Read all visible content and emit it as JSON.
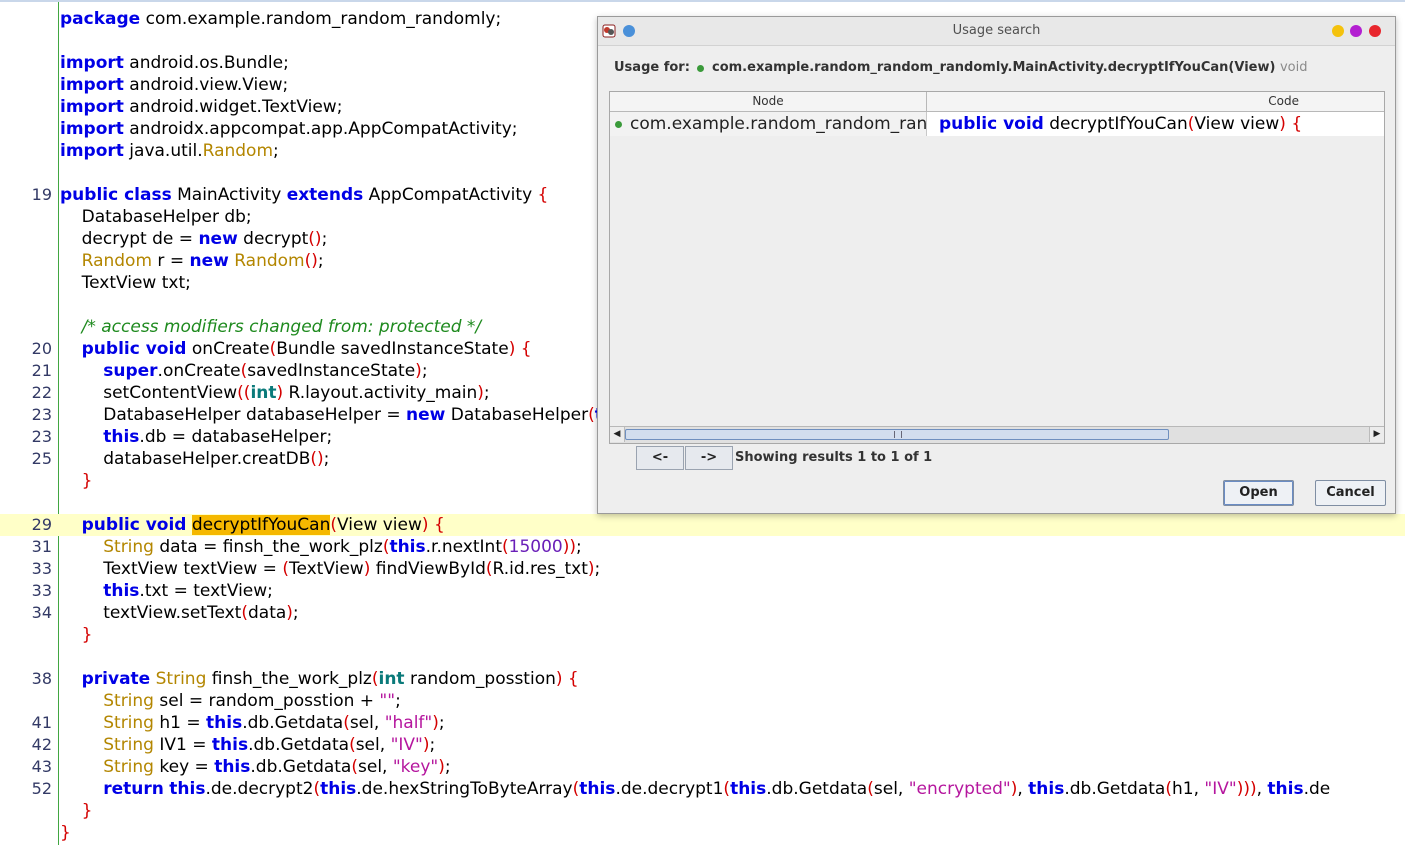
{
  "editor": {
    "lines": [
      {
        "num": "",
        "tokens": [
          {
            "t": "package",
            "c": "kw"
          },
          {
            "t": " com.example.random_random_randomly;",
            "c": ""
          }
        ]
      },
      {
        "num": "",
        "tokens": []
      },
      {
        "num": "",
        "tokens": [
          {
            "t": "import",
            "c": "kw"
          },
          {
            "t": " android.os.Bundle;",
            "c": ""
          }
        ]
      },
      {
        "num": "",
        "tokens": [
          {
            "t": "import",
            "c": "kw"
          },
          {
            "t": " android.view.View;",
            "c": ""
          }
        ]
      },
      {
        "num": "",
        "tokens": [
          {
            "t": "import",
            "c": "kw"
          },
          {
            "t": " android.widget.TextView;",
            "c": ""
          }
        ]
      },
      {
        "num": "",
        "tokens": [
          {
            "t": "import",
            "c": "kw"
          },
          {
            "t": " androidx.appcompat.app.AppCompatActivity;",
            "c": ""
          }
        ]
      },
      {
        "num": "",
        "tokens": [
          {
            "t": "import",
            "c": "kw"
          },
          {
            "t": " java.util.",
            "c": ""
          },
          {
            "t": "Random",
            "c": "ty"
          },
          {
            "t": ";",
            "c": ""
          }
        ]
      },
      {
        "num": "",
        "tokens": []
      },
      {
        "num": "19",
        "tokens": [
          {
            "t": "public class",
            "c": "kw"
          },
          {
            "t": " MainActivity ",
            "c": ""
          },
          {
            "t": "extends",
            "c": "kw"
          },
          {
            "t": " AppCompatActivity ",
            "c": ""
          },
          {
            "t": "{",
            "c": "br"
          }
        ]
      },
      {
        "num": "",
        "tokens": [
          {
            "t": "    DatabaseHelper db;",
            "c": ""
          }
        ]
      },
      {
        "num": "",
        "tokens": [
          {
            "t": "    decrypt de = ",
            "c": ""
          },
          {
            "t": "new",
            "c": "kw"
          },
          {
            "t": " decrypt",
            "c": ""
          },
          {
            "t": "()",
            "c": "br"
          },
          {
            "t": ";",
            "c": ""
          }
        ]
      },
      {
        "num": "",
        "tokens": [
          {
            "t": "    ",
            "c": ""
          },
          {
            "t": "Random",
            "c": "ty"
          },
          {
            "t": " r = ",
            "c": ""
          },
          {
            "t": "new",
            "c": "kw"
          },
          {
            "t": " ",
            "c": ""
          },
          {
            "t": "Random",
            "c": "ty"
          },
          {
            "t": "()",
            "c": "br"
          },
          {
            "t": ";",
            "c": ""
          }
        ]
      },
      {
        "num": "",
        "tokens": [
          {
            "t": "    TextView txt;",
            "c": ""
          }
        ]
      },
      {
        "num": "",
        "tokens": []
      },
      {
        "num": "",
        "tokens": [
          {
            "t": "    /* access modifiers changed from: protected */",
            "c": "cm"
          }
        ]
      },
      {
        "num": "20",
        "tokens": [
          {
            "t": "    ",
            "c": ""
          },
          {
            "t": "public void",
            "c": "kw"
          },
          {
            "t": " onCreate",
            "c": ""
          },
          {
            "t": "(",
            "c": "br"
          },
          {
            "t": "Bundle savedInstanceState",
            "c": ""
          },
          {
            "t": ")",
            "c": "br"
          },
          {
            "t": " ",
            "c": ""
          },
          {
            "t": "{",
            "c": "br"
          }
        ]
      },
      {
        "num": "21",
        "tokens": [
          {
            "t": "        ",
            "c": ""
          },
          {
            "t": "super",
            "c": "kw"
          },
          {
            "t": ".onCreate",
            "c": ""
          },
          {
            "t": "(",
            "c": "br"
          },
          {
            "t": "savedInstanceState",
            "c": ""
          },
          {
            "t": ")",
            "c": "br"
          },
          {
            "t": ";",
            "c": ""
          }
        ]
      },
      {
        "num": "22",
        "tokens": [
          {
            "t": "        setContentView",
            "c": ""
          },
          {
            "t": "((",
            "c": "br"
          },
          {
            "t": "int",
            "c": "kt"
          },
          {
            "t": ")",
            "c": "br"
          },
          {
            "t": " R.layout.activity_main",
            "c": ""
          },
          {
            "t": ")",
            "c": "br"
          },
          {
            "t": ";",
            "c": ""
          }
        ]
      },
      {
        "num": "23",
        "tokens": [
          {
            "t": "        DatabaseHelper databaseHelper = ",
            "c": ""
          },
          {
            "t": "new",
            "c": "kw"
          },
          {
            "t": " DatabaseHelper",
            "c": ""
          },
          {
            "t": "(",
            "c": "br"
          },
          {
            "t": "this",
            "c": "kw"
          },
          {
            "t": ")",
            "c": "br"
          },
          {
            "t": ";",
            "c": ""
          }
        ]
      },
      {
        "num": "23",
        "tokens": [
          {
            "t": "        ",
            "c": ""
          },
          {
            "t": "this",
            "c": "kw"
          },
          {
            "t": ".db = databaseHelper;",
            "c": ""
          }
        ]
      },
      {
        "num": "25",
        "tokens": [
          {
            "t": "        databaseHelper.creatDB",
            "c": ""
          },
          {
            "t": "()",
            "c": "br"
          },
          {
            "t": ";",
            "c": ""
          }
        ]
      },
      {
        "num": "",
        "tokens": [
          {
            "t": "    ",
            "c": ""
          },
          {
            "t": "}",
            "c": "br"
          }
        ]
      },
      {
        "num": "",
        "tokens": []
      },
      {
        "num": "29",
        "hl": true,
        "tokens": [
          {
            "t": "    ",
            "c": ""
          },
          {
            "t": "public void",
            "c": "kw"
          },
          {
            "t": " ",
            "c": ""
          },
          {
            "t": "decryptIfYouCan",
            "c": "mark"
          },
          {
            "t": "(",
            "c": "br"
          },
          {
            "t": "View view",
            "c": ""
          },
          {
            "t": ")",
            "c": "br"
          },
          {
            "t": " ",
            "c": ""
          },
          {
            "t": "{",
            "c": "br"
          }
        ]
      },
      {
        "num": "31",
        "tokens": [
          {
            "t": "        ",
            "c": ""
          },
          {
            "t": "String",
            "c": "ty"
          },
          {
            "t": " data = finsh_the_work_plz",
            "c": ""
          },
          {
            "t": "(",
            "c": "br"
          },
          {
            "t": "this",
            "c": "kw"
          },
          {
            "t": ".r.nextInt",
            "c": ""
          },
          {
            "t": "(",
            "c": "br"
          },
          {
            "t": "15000",
            "c": "num"
          },
          {
            "t": "))",
            "c": "br"
          },
          {
            "t": ";",
            "c": ""
          }
        ]
      },
      {
        "num": "33",
        "tokens": [
          {
            "t": "        TextView textView = ",
            "c": ""
          },
          {
            "t": "(",
            "c": "br"
          },
          {
            "t": "TextView",
            "c": ""
          },
          {
            "t": ")",
            "c": "br"
          },
          {
            "t": " findViewById",
            "c": ""
          },
          {
            "t": "(",
            "c": "br"
          },
          {
            "t": "R.id.res_txt",
            "c": ""
          },
          {
            "t": ")",
            "c": "br"
          },
          {
            "t": ";",
            "c": ""
          }
        ]
      },
      {
        "num": "33",
        "tokens": [
          {
            "t": "        ",
            "c": ""
          },
          {
            "t": "this",
            "c": "kw"
          },
          {
            "t": ".txt = textView;",
            "c": ""
          }
        ]
      },
      {
        "num": "34",
        "tokens": [
          {
            "t": "        textView.setText",
            "c": ""
          },
          {
            "t": "(",
            "c": "br"
          },
          {
            "t": "data",
            "c": ""
          },
          {
            "t": ")",
            "c": "br"
          },
          {
            "t": ";",
            "c": ""
          }
        ]
      },
      {
        "num": "",
        "tokens": [
          {
            "t": "    ",
            "c": ""
          },
          {
            "t": "}",
            "c": "br"
          }
        ]
      },
      {
        "num": "",
        "tokens": []
      },
      {
        "num": "38",
        "tokens": [
          {
            "t": "    ",
            "c": ""
          },
          {
            "t": "private",
            "c": "kw"
          },
          {
            "t": " ",
            "c": ""
          },
          {
            "t": "String",
            "c": "ty"
          },
          {
            "t": " finsh_the_work_plz",
            "c": ""
          },
          {
            "t": "(",
            "c": "br"
          },
          {
            "t": "int",
            "c": "kt"
          },
          {
            "t": " random_posstion",
            "c": ""
          },
          {
            "t": ")",
            "c": "br"
          },
          {
            "t": " ",
            "c": ""
          },
          {
            "t": "{",
            "c": "br"
          }
        ]
      },
      {
        "num": "",
        "tokens": [
          {
            "t": "        ",
            "c": ""
          },
          {
            "t": "String",
            "c": "ty"
          },
          {
            "t": " sel = random_posstion + ",
            "c": ""
          },
          {
            "t": "\"\"",
            "c": "str"
          },
          {
            "t": ";",
            "c": ""
          }
        ]
      },
      {
        "num": "41",
        "tokens": [
          {
            "t": "        ",
            "c": ""
          },
          {
            "t": "String",
            "c": "ty"
          },
          {
            "t": " h1 = ",
            "c": ""
          },
          {
            "t": "this",
            "c": "kw"
          },
          {
            "t": ".db.Getdata",
            "c": ""
          },
          {
            "t": "(",
            "c": "br"
          },
          {
            "t": "sel, ",
            "c": ""
          },
          {
            "t": "\"half\"",
            "c": "str"
          },
          {
            "t": ")",
            "c": "br"
          },
          {
            "t": ";",
            "c": ""
          }
        ]
      },
      {
        "num": "42",
        "tokens": [
          {
            "t": "        ",
            "c": ""
          },
          {
            "t": "String",
            "c": "ty"
          },
          {
            "t": " IV1 = ",
            "c": ""
          },
          {
            "t": "this",
            "c": "kw"
          },
          {
            "t": ".db.Getdata",
            "c": ""
          },
          {
            "t": "(",
            "c": "br"
          },
          {
            "t": "sel, ",
            "c": ""
          },
          {
            "t": "\"IV\"",
            "c": "str"
          },
          {
            "t": ")",
            "c": "br"
          },
          {
            "t": ";",
            "c": ""
          }
        ]
      },
      {
        "num": "43",
        "tokens": [
          {
            "t": "        ",
            "c": ""
          },
          {
            "t": "String",
            "c": "ty"
          },
          {
            "t": " key = ",
            "c": ""
          },
          {
            "t": "this",
            "c": "kw"
          },
          {
            "t": ".db.Getdata",
            "c": ""
          },
          {
            "t": "(",
            "c": "br"
          },
          {
            "t": "sel, ",
            "c": ""
          },
          {
            "t": "\"key\"",
            "c": "str"
          },
          {
            "t": ")",
            "c": "br"
          },
          {
            "t": ";",
            "c": ""
          }
        ]
      },
      {
        "num": "52",
        "tokens": [
          {
            "t": "        ",
            "c": ""
          },
          {
            "t": "return",
            "c": "kw"
          },
          {
            "t": " ",
            "c": ""
          },
          {
            "t": "this",
            "c": "kw"
          },
          {
            "t": ".de.decrypt2",
            "c": ""
          },
          {
            "t": "(",
            "c": "br"
          },
          {
            "t": "this",
            "c": "kw"
          },
          {
            "t": ".de.hexStringToByteArray",
            "c": ""
          },
          {
            "t": "(",
            "c": "br"
          },
          {
            "t": "this",
            "c": "kw"
          },
          {
            "t": ".de.decrypt1",
            "c": ""
          },
          {
            "t": "(",
            "c": "br"
          },
          {
            "t": "this",
            "c": "kw"
          },
          {
            "t": ".db.Getdata",
            "c": ""
          },
          {
            "t": "(",
            "c": "br"
          },
          {
            "t": "sel, ",
            "c": ""
          },
          {
            "t": "\"encrypted\"",
            "c": "str"
          },
          {
            "t": ")",
            "c": "br"
          },
          {
            "t": ", ",
            "c": ""
          },
          {
            "t": "this",
            "c": "kw"
          },
          {
            "t": ".db.Getdata",
            "c": ""
          },
          {
            "t": "(",
            "c": "br"
          },
          {
            "t": "h1, ",
            "c": ""
          },
          {
            "t": "\"IV\"",
            "c": "str"
          },
          {
            "t": ")))",
            "c": "br"
          },
          {
            "t": ", ",
            "c": ""
          },
          {
            "t": "this",
            "c": "kw"
          },
          {
            "t": ".de",
            "c": ""
          }
        ]
      },
      {
        "num": "",
        "tokens": [
          {
            "t": "    ",
            "c": ""
          },
          {
            "t": "}",
            "c": "br"
          }
        ]
      },
      {
        "num": "",
        "tokens": [
          {
            "t": "}",
            "c": "br"
          }
        ]
      }
    ]
  },
  "dialog": {
    "title": "Usage search",
    "usage_label": "Usage for:",
    "usage_target": "com.example.random_random_randomly.MainActivity.decryptIfYouCan(View) ",
    "usage_type": "void",
    "table": {
      "columns": [
        "Node",
        "Code"
      ],
      "rows": [
        {
          "node": "com.example.random_random_randomly.MainActivity",
          "code": [
            {
              "t": "public void",
              "c": "kw"
            },
            {
              "t": " decryptIfYouCan",
              "c": ""
            },
            {
              "t": "(",
              "c": "br"
            },
            {
              "t": "View view",
              "c": ""
            },
            {
              "t": ")",
              "c": "br"
            },
            {
              "t": " ",
              "c": ""
            },
            {
              "t": "{",
              "c": "br"
            }
          ]
        }
      ]
    },
    "nav": {
      "prev": "<-",
      "next": "->"
    },
    "results_text": "Showing results 1 to 1 of 1",
    "open_label": "Open",
    "cancel_label": "Cancel",
    "colors": {
      "window_min": "#f4c20d",
      "window_max": "#b31fd1",
      "window_close": "#e8262d",
      "pin": "#4a90d9",
      "highlight_line": "#ffffc8",
      "search_mark": "#f5b800"
    }
  }
}
